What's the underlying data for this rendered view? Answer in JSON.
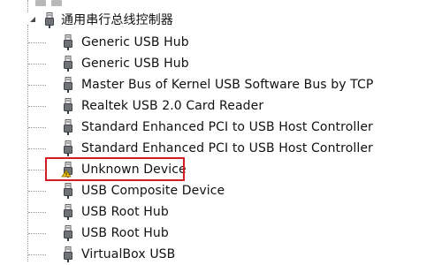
{
  "tree": {
    "group_label": "通用串行总线控制器",
    "items": [
      {
        "label": "Generic USB Hub",
        "icon": "usb-plug-icon"
      },
      {
        "label": "Generic USB Hub",
        "icon": "usb-plug-icon"
      },
      {
        "label": "Master Bus of Kernel USB Software Bus by TCP",
        "icon": "usb-plug-icon"
      },
      {
        "label": "Realtek USB 2.0 Card Reader",
        "icon": "usb-plug-icon"
      },
      {
        "label": "Standard Enhanced PCI to USB Host Controller",
        "icon": "usb-plug-icon"
      },
      {
        "label": "Standard Enhanced PCI to USB Host Controller",
        "icon": "usb-plug-icon"
      },
      {
        "label": "Unknown Device",
        "icon": "usb-warning-icon"
      },
      {
        "label": "USB Composite Device",
        "icon": "usb-plug-icon"
      },
      {
        "label": "USB Root Hub",
        "icon": "usb-plug-icon"
      },
      {
        "label": "USB Root Hub",
        "icon": "usb-plug-icon"
      },
      {
        "label": "VirtualBox USB",
        "icon": "usb-plug-icon"
      }
    ]
  },
  "colors": {
    "highlight_border": "#d31d24",
    "guide_line": "#9a9a9a",
    "warning": "#f2c200"
  }
}
